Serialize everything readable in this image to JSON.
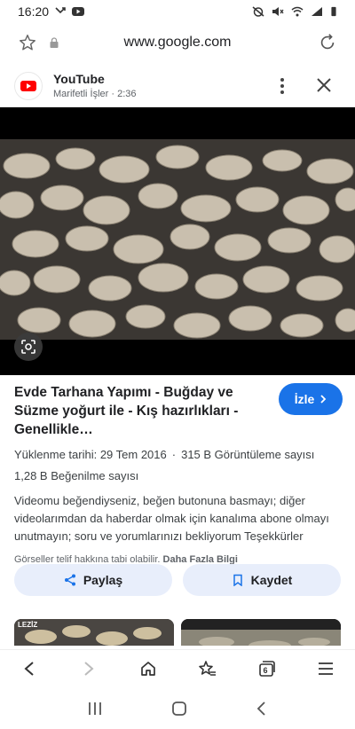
{
  "status_bar": {
    "time": "16:20"
  },
  "address_bar": {
    "url": "www.google.com"
  },
  "source": {
    "name": "YouTube",
    "meta": "Marifetli İşler · 2:36"
  },
  "result": {
    "title": "Evde Tarhana Yapımı - Buğday ve Süzme yoğurt ile - Kış hazırlıkları - Genellikle…",
    "visit_label": "İzle",
    "upload_date": "Yüklenme tarihi: 29 Tem 2016",
    "views": "315 B Görüntüleme sayısı",
    "likes": "1,28 B Beğenilme sayısı",
    "description": "Videomu beğendiyseniz, beğen butonuna basmayı; diğer videolarımdan da haberdar olmak için kanalıma abone olmayı unutmayın; soru ve yorumlarınızı bekliyorum Teşekkürler",
    "copyright_text": "Görseller telif hakkına tabi olabilir.",
    "more_info": "Daha Fazla Bilgi",
    "share_label": "Paylaş",
    "save_label": "Kaydet"
  },
  "related": {
    "thumb1_label": "LEZİZ"
  },
  "browser_nav": {
    "tab_count": "6"
  },
  "colors": {
    "accent": "#1a73e8",
    "action_bg": "#e8eefb",
    "youtube_red": "#ff0000"
  }
}
